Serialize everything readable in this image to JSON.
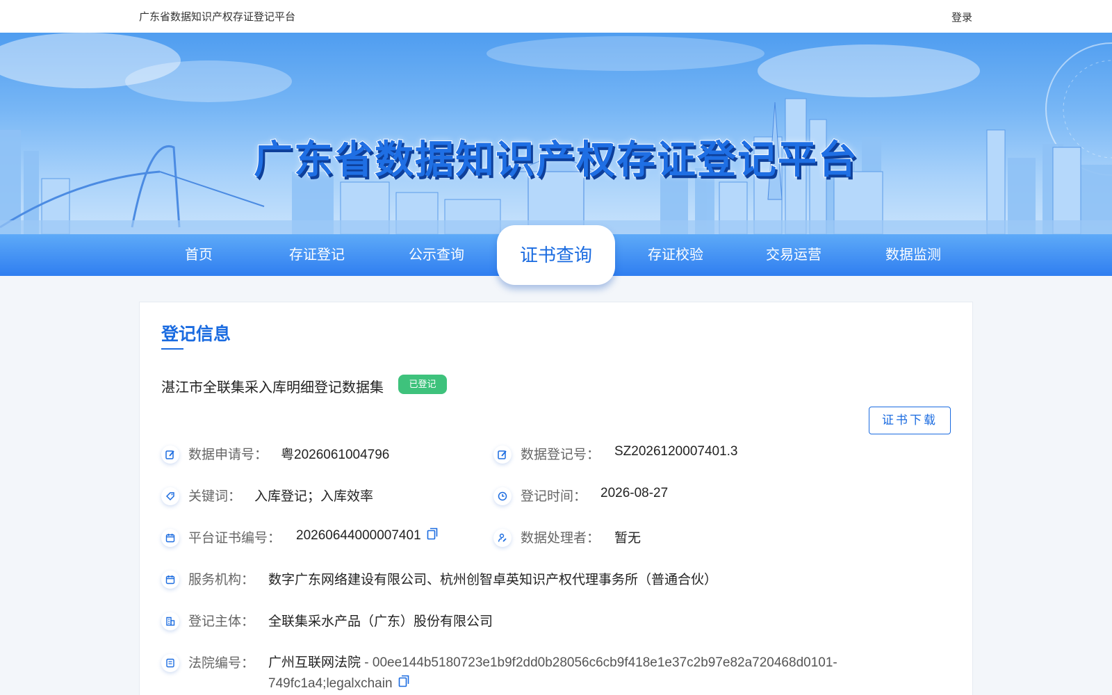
{
  "topbar": {
    "site_name": "广东省数据知识产权存证登记平台",
    "login": "登录"
  },
  "banner": {
    "title": "广东省数据知识产权存证登记平台"
  },
  "nav": {
    "items": [
      "首页",
      "存证登记",
      "公示查询",
      "证书查询",
      "存证校验",
      "交易运营",
      "数据监测"
    ],
    "active": "证书查询"
  },
  "record": {
    "section_title": "登记信息",
    "dataset_name": "湛江市全联集采入库明细登记数据集",
    "status": "已登记",
    "download_label": "证书下载",
    "fields": {
      "app_no_label": "数据申请号：",
      "app_no": "粤2026061004796",
      "reg_no_label": "数据登记号：",
      "reg_no": "SZ2026120007401.3",
      "keywords_label": "关键词：",
      "keywords": "入库登记；入库效率",
      "reg_time_label": "登记时间：",
      "reg_time": "2026-08-27",
      "cert_no_label": "平台证书编号：",
      "cert_no": "20260644000007401",
      "processor_label": "数据处理者：",
      "processor": "暂无",
      "service_label": "服务机构：",
      "service": "数字广东网络建设有限公司、杭州创智卓英知识产权代理事务所（普通合伙）",
      "subject_label": "登记主体：",
      "subject": "全联集采水产品（广东）股份有限公司",
      "court_label": "法院编号：",
      "court_name": "广州互联网法院",
      "court_hash": " - 00ee144b5180723e1b9f2dd0b28056c6cb9f418e1e37c2b97e82a720468d0101-749fc1a4;legalxchain"
    }
  },
  "icons": {
    "edit": "edit-icon",
    "tag": "tag-icon",
    "calendar": "calendar-icon",
    "clock": "clock-icon",
    "user": "user-edit-icon",
    "building": "building-icon",
    "document": "document-icon",
    "copy": "copy-icon"
  },
  "colors": {
    "primary": "#1a6be0",
    "badge": "#3ec27c"
  }
}
